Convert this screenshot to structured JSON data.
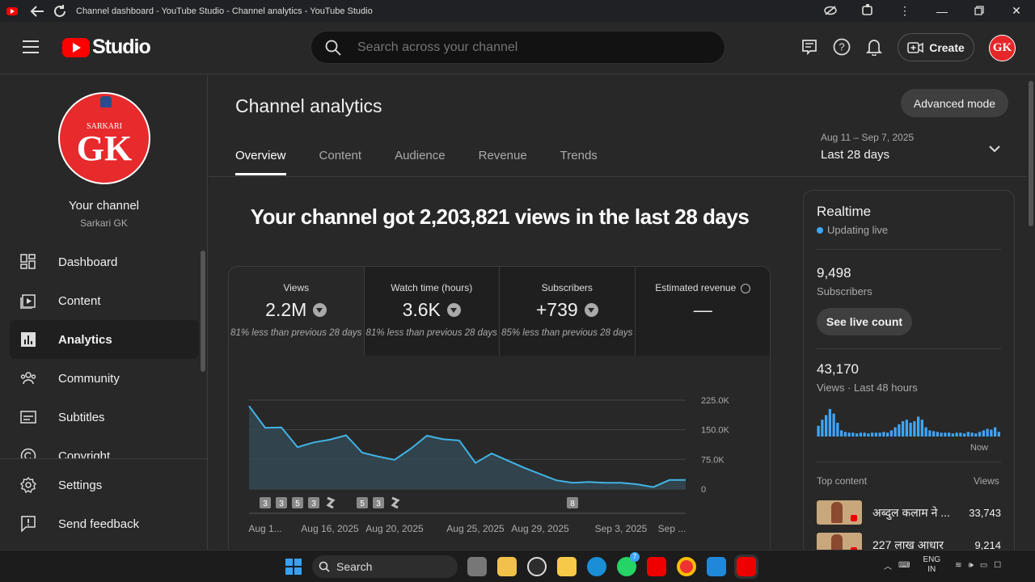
{
  "browser": {
    "title": "Channel dashboard - YouTube Studio - Channel analytics - YouTube Studio",
    "icons": [
      "back-arrow-icon",
      "refresh-icon",
      "eye-off-icon",
      "extensions-icon",
      "more-vert-icon",
      "minimize-icon",
      "restore-icon",
      "close-icon"
    ]
  },
  "header": {
    "logo_text": "Studio",
    "search_placeholder": "Search across your channel",
    "create_label": "Create",
    "avatar_text": "GK"
  },
  "sidebar": {
    "avatar_small": "SARKARI",
    "avatar_big": "GK",
    "channel_title": "Your channel",
    "channel_name": "Sarkari GK",
    "items": [
      {
        "label": "Dashboard",
        "icon": "dashboard-icon"
      },
      {
        "label": "Content",
        "icon": "content-icon"
      },
      {
        "label": "Analytics",
        "icon": "analytics-icon",
        "active": true
      },
      {
        "label": "Community",
        "icon": "community-icon"
      },
      {
        "label": "Subtitles",
        "icon": "subtitles-icon"
      },
      {
        "label": "Copyright",
        "icon": "copyright-icon"
      }
    ],
    "bottom_items": [
      {
        "label": "Settings",
        "icon": "settings-icon"
      },
      {
        "label": "Send feedback",
        "icon": "feedback-icon"
      }
    ]
  },
  "main": {
    "title": "Channel analytics",
    "advanced_mode_label": "Advanced mode",
    "tabs": [
      {
        "label": "Overview",
        "active": true
      },
      {
        "label": "Content"
      },
      {
        "label": "Audience"
      },
      {
        "label": "Revenue"
      },
      {
        "label": "Trends"
      }
    ],
    "date_range_dates": "Aug 11 – Sep 7, 2025",
    "date_range_label": "Last 28 days",
    "headline": "Your channel got 2,203,821 views in the last 28 days",
    "metrics": [
      {
        "label": "Views",
        "value": "2.2M",
        "compare": "81% less than previous 28 days"
      },
      {
        "label": "Watch time (hours)",
        "value": "3.6K",
        "compare": "81% less than previous 28 days"
      },
      {
        "label": "Subscribers",
        "value": "+739",
        "compare": "85% less than previous 28 days"
      },
      {
        "label": "Estimated revenue",
        "value": "—",
        "compare": ""
      }
    ]
  },
  "chart_data": {
    "type": "area",
    "title": "",
    "xlabel": "",
    "ylabel": "",
    "ylim": [
      0,
      225000
    ],
    "yticks": [
      0,
      75000,
      150000,
      225000
    ],
    "ytick_labels": [
      "0",
      "75.0K",
      "150.0K",
      "225.0K"
    ],
    "xtick_labels": [
      "Aug 1...",
      "Aug 16, 2025",
      "Aug 20, 2025",
      "Aug 25, 2025",
      "Aug 29, 2025",
      "Sep 3, 2025",
      "Sep ..."
    ],
    "grid": true,
    "line_color": "#41b4e6",
    "x": [
      "Aug 11",
      "Aug 12",
      "Aug 13",
      "Aug 14",
      "Aug 15",
      "Aug 16",
      "Aug 17",
      "Aug 18",
      "Aug 19",
      "Aug 20",
      "Aug 21",
      "Aug 22",
      "Aug 23",
      "Aug 24",
      "Aug 25",
      "Aug 26",
      "Aug 27",
      "Aug 28",
      "Aug 29",
      "Aug 30",
      "Aug 31",
      "Sep 1",
      "Sep 2",
      "Sep 3",
      "Sep 4",
      "Sep 5",
      "Sep 6",
      "Sep 7"
    ],
    "values": [
      210000,
      155000,
      156000,
      106000,
      118000,
      125000,
      136000,
      92000,
      82000,
      74000,
      102000,
      135000,
      126000,
      123000,
      66000,
      90000,
      72000,
      54000,
      38000,
      22000,
      16000,
      18000,
      16000,
      16000,
      12000,
      5000,
      23000,
      23000
    ],
    "markers": [
      {
        "day_index": 1,
        "label": "3"
      },
      {
        "day_index": 2,
        "label": "3"
      },
      {
        "day_index": 3,
        "label": "5"
      },
      {
        "day_index": 4,
        "label": "3"
      },
      {
        "day_index": 5,
        "label": "shorts"
      },
      {
        "day_index": 7,
        "label": "5"
      },
      {
        "day_index": 8,
        "label": "3"
      },
      {
        "day_index": 9,
        "label": "shorts"
      },
      {
        "day_index": 20,
        "label": "8"
      }
    ]
  },
  "realtime": {
    "title": "Realtime",
    "status": "Updating live",
    "subscribers_value": "9,498",
    "subscribers_label": "Subscribers",
    "live_count_label": "See live count",
    "views_value": "43,170",
    "views_label": "Views · Last 48 hours",
    "now_label": "Now",
    "bar_color": "#3ea6ff",
    "hourly_views": [
      14,
      22,
      28,
      36,
      30,
      18,
      8,
      6,
      5,
      5,
      4,
      5,
      5,
      4,
      5,
      5,
      5,
      6,
      5,
      8,
      12,
      16,
      20,
      22,
      18,
      20,
      26,
      22,
      12,
      8,
      7,
      6,
      5,
      5,
      5,
      4,
      5,
      5,
      4,
      6,
      5,
      4,
      6,
      8,
      10,
      9,
      12,
      6
    ],
    "top_content_label": "Top content",
    "views_col_label": "Views",
    "top_content": [
      {
        "title": "अब्दुल कलाम ने ...",
        "views": "33,743"
      },
      {
        "title": "227 लाख आधार",
        "views": "9,214"
      }
    ]
  },
  "taskbar": {
    "search_label": "Search",
    "lang_top": "ENG",
    "lang_bottom": "IN",
    "whatsapp_badge": "7",
    "apps": [
      "task-view-icon",
      "file-explorer-icon",
      "chatgpt-icon",
      "sticky-notes-icon",
      "edge-icon",
      "whatsapp-icon",
      "youtube-icon",
      "chrome-icon",
      "vscode-icon",
      "youtube-studio-icon"
    ]
  }
}
